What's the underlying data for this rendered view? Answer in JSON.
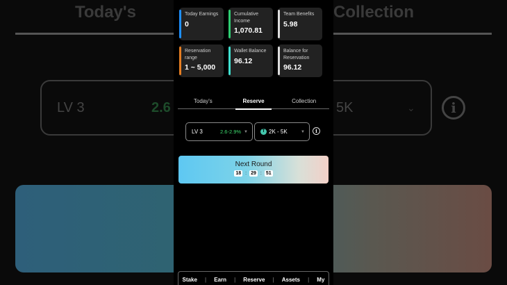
{
  "background": {
    "tab_left": "Today's",
    "tab_right": "Collection",
    "level": "LV 3",
    "percent": "2.6",
    "range_suffix": "5K"
  },
  "stats": [
    {
      "label": "Today Earnings",
      "value": "0",
      "color": "#1e90ff"
    },
    {
      "label": "Cumulative Income",
      "value": "1,070.81",
      "color": "#2ecc71"
    },
    {
      "label": "Team Benefits",
      "value": "5.98",
      "color": "#dddddd"
    },
    {
      "label": "Reservation range",
      "value": "1 ~ 5,000",
      "color": "#e67e22"
    },
    {
      "label": "Wallet Balance",
      "value": "96.12",
      "color": "#40e0d0"
    },
    {
      "label": "Balance for Reservation",
      "value": "96.12",
      "color": "#dddddd"
    }
  ],
  "tabs": [
    {
      "label": "Today's",
      "active": false
    },
    {
      "label": "Reserve",
      "active": true
    },
    {
      "label": "Collection",
      "active": false
    }
  ],
  "level_select": {
    "level": "LV 3",
    "percent": "2.6-2.9%",
    "chevron_icon": "chevron-down-icon"
  },
  "range_select": {
    "token_icon": "tether-icon",
    "token_glyph": "T",
    "range": "2K - 5K",
    "chevron_icon": "chevron-down-icon"
  },
  "info_icon": {
    "glyph": "i"
  },
  "next_round": {
    "title": "Next Round",
    "hours": "18",
    "minutes": "29",
    "seconds": "51"
  },
  "nav": [
    "Stake",
    "Earn",
    "Reserve",
    "Assets",
    "My"
  ],
  "colors": {
    "accent_green": "#3ddc6e",
    "round_gradient_start": "#5ec8f2",
    "round_gradient_end": "#f3d0c8"
  }
}
